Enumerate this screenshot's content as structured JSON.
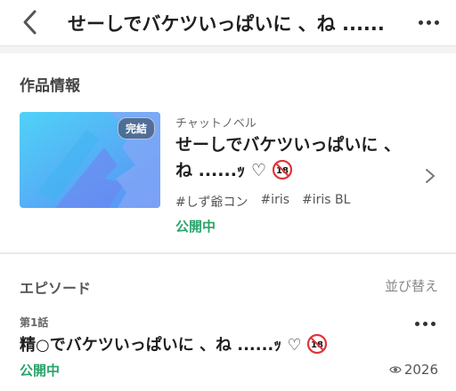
{
  "header": {
    "title": "せーしでバケツいっぱいに 、ね ......"
  },
  "work_info": {
    "section_title": "作品情報",
    "badge": "完結",
    "genre": "チャットノベル",
    "title": "せーしでバケツいっぱいに 、ね ......ｯ ♡",
    "age_rating": "18",
    "tags": [
      "#しず爺コン",
      "#iris",
      "#iris BL"
    ],
    "status": "公開中"
  },
  "episodes": {
    "section_title": "エピソード",
    "sort_label": "並び替え",
    "items": [
      {
        "number": "第1話",
        "title": "精○でバケツいっぱいに 、ね ......ｯ ♡",
        "status": "公開中",
        "views": "2026"
      }
    ]
  },
  "colors": {
    "accent_green": "#2aa36b",
    "thumb_blue": "#5aa0f5"
  }
}
